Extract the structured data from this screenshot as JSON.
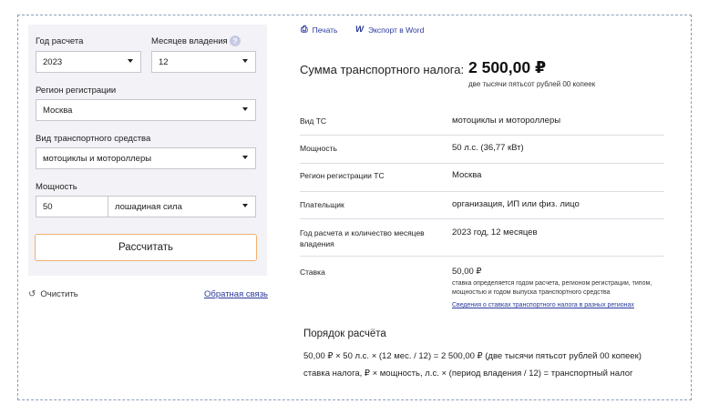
{
  "form": {
    "year_label": "Год расчета",
    "year_value": "2023",
    "months_label": "Месяцев владения",
    "months_value": "12",
    "help_glyph": "?",
    "region_label": "Регион регистрации",
    "region_value": "Москва",
    "vehicle_label": "Вид транспортного средства",
    "vehicle_value": "мотоциклы и мотороллеры",
    "power_label": "Мощность",
    "power_value": "50",
    "power_unit": "лошадиная сила",
    "calc_button": "Рассчитать",
    "clear_label": "Очистить",
    "feedback_label": "Обратная связь"
  },
  "toolbar": {
    "print_label": "Печать",
    "export_label": "Экспорт в Word"
  },
  "result": {
    "sum_label": "Сумма транспортного налога:",
    "sum_value": "2 500,00 ₽",
    "sum_words": "две тысячи пятьсот рублей 00 копеек",
    "rows": [
      {
        "key": "Вид ТС",
        "value": "мотоциклы и мотороллеры"
      },
      {
        "key": "Мощность",
        "value": "50 л.с. (36,77 кВт)"
      },
      {
        "key": "Регион регистрации ТС",
        "value": "Москва"
      },
      {
        "key": "Плательщик",
        "value": "организация, ИП или физ. лицо"
      },
      {
        "key": "Год расчета и количество месяцев владения",
        "value": "2023 год, 12 месяцев"
      },
      {
        "key": "Ставка",
        "value": "50,00 ₽"
      }
    ],
    "rate_note": "ставка определяется годом расчета, регионом регистрации, типом, мощностью и годом выпуска транспортного средства",
    "rate_link": "Сведения о ставках транспортного налога в разных регионах"
  },
  "order": {
    "title": "Порядок расчёта",
    "formula_1": "50,00 ₽ × 50 л.с. × (12 мес. / 12) = 2 500,00 ₽ (две тысячи пятьсот рублей 00 копеек)",
    "formula_2": "ставка налога, ₽ × мощность, л.с. × (период владения / 12) = транспортный налог"
  }
}
